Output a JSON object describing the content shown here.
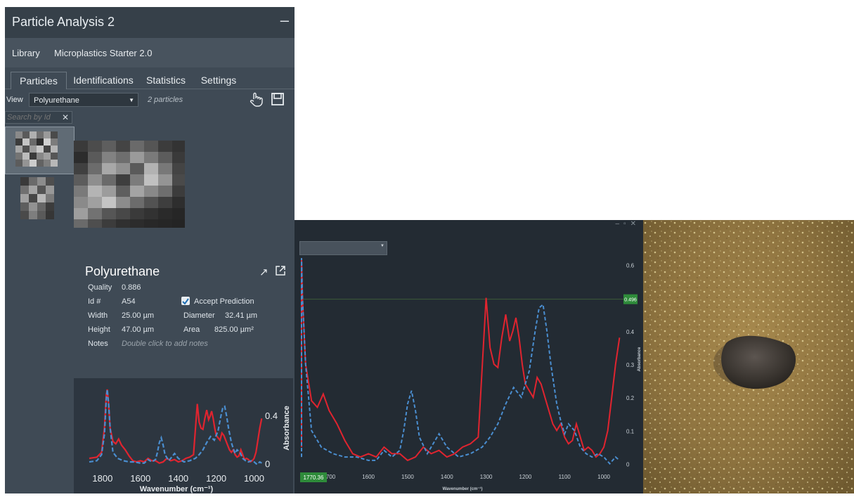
{
  "panel": {
    "title": "Particle Analysis 2",
    "minimize_label": "–",
    "library_label": "Library",
    "library_value": "Microplastics Starter 2.0",
    "tabs": [
      {
        "label": "Particles",
        "active": true
      },
      {
        "label": "Identifications",
        "active": false
      },
      {
        "label": "Statistics",
        "active": false
      },
      {
        "label": "Settings",
        "active": false
      }
    ],
    "view_label": "View",
    "view_value": "Polyurethane",
    "particles_count": "2 particles",
    "search_placeholder": "Search by Id",
    "search_clear": "✕"
  },
  "details": {
    "name": "Polyurethane",
    "quality_label": "Quality",
    "quality_value": "0.886",
    "id_label": "Id #",
    "id_value": "A54",
    "accept_label": "Accept Prediction",
    "accept_checked": true,
    "width_label": "Width",
    "width_value": "25.00 µm",
    "diameter_label": "Diameter",
    "diameter_value": "32.41 µm",
    "height_label": "Height",
    "height_value": "47.00 µm",
    "area_label": "Area",
    "area_value": "825.00 µm²",
    "notes_label": "Notes",
    "notes_placeholder": "Double click to add notes"
  },
  "colors": {
    "measured": "#e0242f",
    "library": "#4a8ed0",
    "panel_bg": "#3f4a55",
    "chart_bg": "#232b33",
    "marker": "#2e8b3a"
  },
  "chart_data": [
    {
      "type": "line",
      "xlabel": "Wavenumber (cm⁻¹)",
      "ylabel": "Absorbance",
      "xlim": [
        1870,
        950
      ],
      "ylim": [
        -0.02,
        0.62
      ],
      "x_ticks": [
        1800,
        1600,
        1400,
        1200,
        1000
      ],
      "x_tick_labels": [
        "1800",
        "1600",
        "1400",
        "1200",
        "1000"
      ],
      "y_ticks": [
        0,
        0.4
      ],
      "y_tick_labels": [
        "0",
        "0.4"
      ],
      "series": [
        {
          "style": "solid",
          "color": "#e0242f",
          "x": [
            1870,
            1830,
            1805,
            1790,
            1780,
            1775,
            1768,
            1760,
            1745,
            1730,
            1715,
            1700,
            1680,
            1660,
            1640,
            1620,
            1600,
            1580,
            1560,
            1540,
            1520,
            1500,
            1480,
            1460,
            1440,
            1420,
            1400,
            1380,
            1360,
            1340,
            1320,
            1300,
            1290,
            1280,
            1270,
            1260,
            1250,
            1240,
            1232,
            1224,
            1216,
            1208,
            1200,
            1190,
            1180,
            1170,
            1160,
            1150,
            1140,
            1130,
            1120,
            1110,
            1100,
            1090,
            1080,
            1070,
            1060,
            1050,
            1040,
            1030,
            1020,
            1010,
            1000,
            990,
            980,
            970,
            960
          ],
          "y": [
            0.05,
            0.06,
            0.1,
            0.3,
            0.58,
            0.62,
            0.5,
            0.3,
            0.19,
            0.17,
            0.21,
            0.16,
            0.12,
            0.07,
            0.03,
            0.02,
            0.03,
            0.02,
            0.05,
            0.03,
            0.03,
            0.01,
            0.02,
            0.05,
            0.03,
            0.04,
            0.02,
            0.03,
            0.05,
            0.06,
            0.08,
            0.5,
            0.35,
            0.3,
            0.29,
            0.38,
            0.45,
            0.37,
            0.4,
            0.44,
            0.38,
            0.3,
            0.24,
            0.22,
            0.2,
            0.26,
            0.24,
            0.2,
            0.16,
            0.12,
            0.1,
            0.12,
            0.08,
            0.06,
            0.07,
            0.12,
            0.08,
            0.04,
            0.05,
            0.04,
            0.02,
            0.03,
            0.05,
            0.1,
            0.2,
            0.3,
            0.38
          ]
        },
        {
          "style": "dashed",
          "color": "#4a8ed0",
          "x": [
            1870,
            1830,
            1805,
            1790,
            1780,
            1775,
            1768,
            1760,
            1745,
            1720,
            1690,
            1660,
            1630,
            1600,
            1580,
            1560,
            1540,
            1520,
            1510,
            1500,
            1490,
            1480,
            1470,
            1450,
            1430,
            1420,
            1410,
            1400,
            1390,
            1370,
            1340,
            1310,
            1290,
            1270,
            1250,
            1230,
            1210,
            1190,
            1175,
            1165,
            1155,
            1145,
            1135,
            1120,
            1110,
            1100,
            1090,
            1075,
            1060,
            1045,
            1030,
            1015,
            1000,
            985,
            970,
            960
          ],
          "y": [
            0.02,
            0.03,
            0.08,
            0.25,
            0.55,
            0.62,
            0.5,
            0.3,
            0.1,
            0.05,
            0.03,
            0.02,
            0.02,
            0.01,
            0.01,
            0.04,
            0.02,
            0.04,
            0.1,
            0.18,
            0.22,
            0.16,
            0.08,
            0.03,
            0.07,
            0.09,
            0.07,
            0.05,
            0.04,
            0.02,
            0.03,
            0.05,
            0.08,
            0.12,
            0.18,
            0.23,
            0.2,
            0.28,
            0.4,
            0.47,
            0.48,
            0.4,
            0.3,
            0.18,
            0.13,
            0.09,
            0.12,
            0.1,
            0.05,
            0.03,
            0.02,
            0.03,
            0.02,
            0.0,
            0.02,
            0.01
          ]
        }
      ]
    },
    {
      "type": "line",
      "xlabel": "Wavenumber (cm⁻¹)",
      "ylabel": "Absorbance",
      "xlim": [
        1770.36,
        950
      ],
      "ylim": [
        -0.02,
        0.65
      ],
      "x_ticks": [
        1700,
        1600,
        1500,
        1400,
        1300,
        1200,
        1100,
        1000
      ],
      "x_tick_labels": [
        "1700",
        "1600",
        "1500",
        "1400",
        "1300",
        "1200",
        "1100",
        "1000"
      ],
      "y_ticks": [
        0,
        0.1,
        0.2,
        0.3,
        0.4,
        0.6
      ],
      "y_tick_labels": [
        "0",
        "0.1",
        "0.2",
        "0.3",
        "0.4",
        "0.6"
      ],
      "cursor_x_label": "1770.36",
      "cursor_y": 0.496,
      "cursor_y_label": "0.496",
      "series_refs": [
        0,
        1
      ]
    }
  ]
}
